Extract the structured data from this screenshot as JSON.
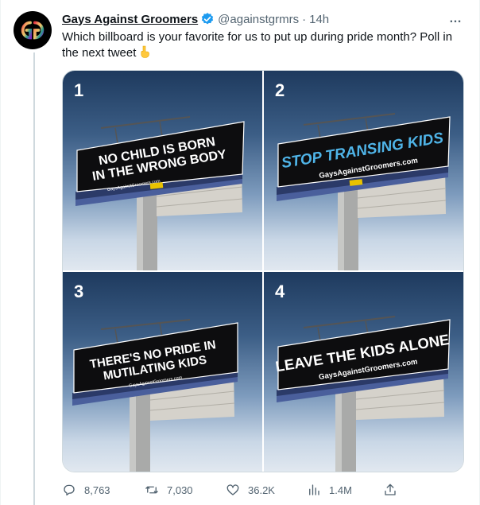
{
  "tweet": {
    "display_name": "Gays Against Groomers",
    "handle": "@againstgrmrs",
    "separator": "·",
    "time": "14h",
    "text": "Which billboard is your favorite for us to put up during pride month? Poll in the next tweet",
    "verified": true,
    "more_icon": "…"
  },
  "media": {
    "images": [
      {
        "number": "1",
        "line1": "NO CHILD IS BORN",
        "line2": "IN THE WRONG BODY",
        "site": "GaysAgainstGroomers.com"
      },
      {
        "number": "2",
        "line1": "STOP TRANSING KIDS",
        "site": "GaysAgainstGroomers.com"
      },
      {
        "number": "3",
        "line1": "THERE'S NO PRIDE IN",
        "line2": "MUTILATING KIDS",
        "site": "GaysAgainstGroomers.com"
      },
      {
        "number": "4",
        "line1": "LEAVE THE KIDS ALONE",
        "site": "GaysAgainstGroomers.com"
      }
    ]
  },
  "actions": {
    "replies": "8,763",
    "retweets": "7,030",
    "likes": "36.2K",
    "views": "1.4M"
  },
  "colors": {
    "verified": "#1d9bf0",
    "secondary_text": "#536471",
    "pink": "#f26a9d",
    "light_blue": "#4fb4e8"
  }
}
